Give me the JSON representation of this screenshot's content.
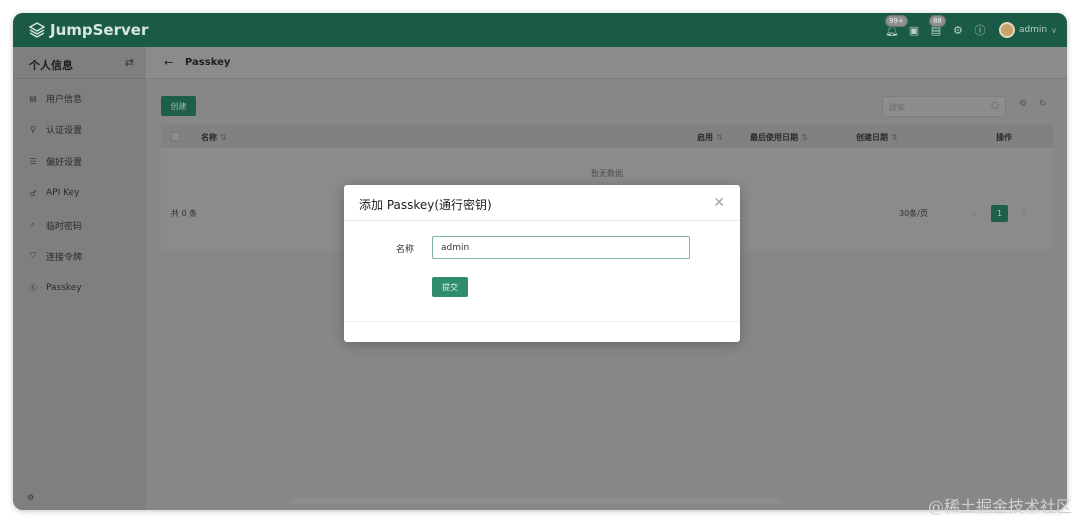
{
  "app": {
    "logo_text": "JumpServer"
  },
  "header": {
    "notify_badge": "99+",
    "ticket_badge": "88",
    "user_name": "admin"
  },
  "sidebar": {
    "title": "个人信息",
    "items": [
      {
        "label": "用户信息",
        "icon": "id-card-icon"
      },
      {
        "label": "认证设置",
        "icon": "user-auth-icon"
      },
      {
        "label": "偏好设置",
        "icon": "sliders-icon"
      },
      {
        "label": "API Key",
        "icon": "key-icon"
      },
      {
        "label": "临时密码",
        "icon": "password-icon"
      },
      {
        "label": "连接令牌",
        "icon": "token-icon"
      },
      {
        "label": "Passkey",
        "icon": "passkey-icon"
      }
    ]
  },
  "page": {
    "title": "Passkey",
    "create_label": "创建",
    "search_placeholder": "搜索",
    "columns": {
      "name": "名称",
      "enabled": "启用",
      "last_used": "最后使用日期",
      "created": "创建日期",
      "actions": "操作"
    },
    "empty_text": "暂无数据",
    "total_text": "共 0 条",
    "page_size": "30条/页",
    "current_page": "1"
  },
  "modal": {
    "title": "添加 Passkey(通行密钥)",
    "name_label": "名称",
    "name_value": "admin",
    "submit_label": "提交"
  },
  "watermark": "@稀土掘金技术社区",
  "colors": {
    "header_bg": "#1a5a47",
    "primary": "#2f8c6d",
    "overlay_content": "#878787"
  }
}
